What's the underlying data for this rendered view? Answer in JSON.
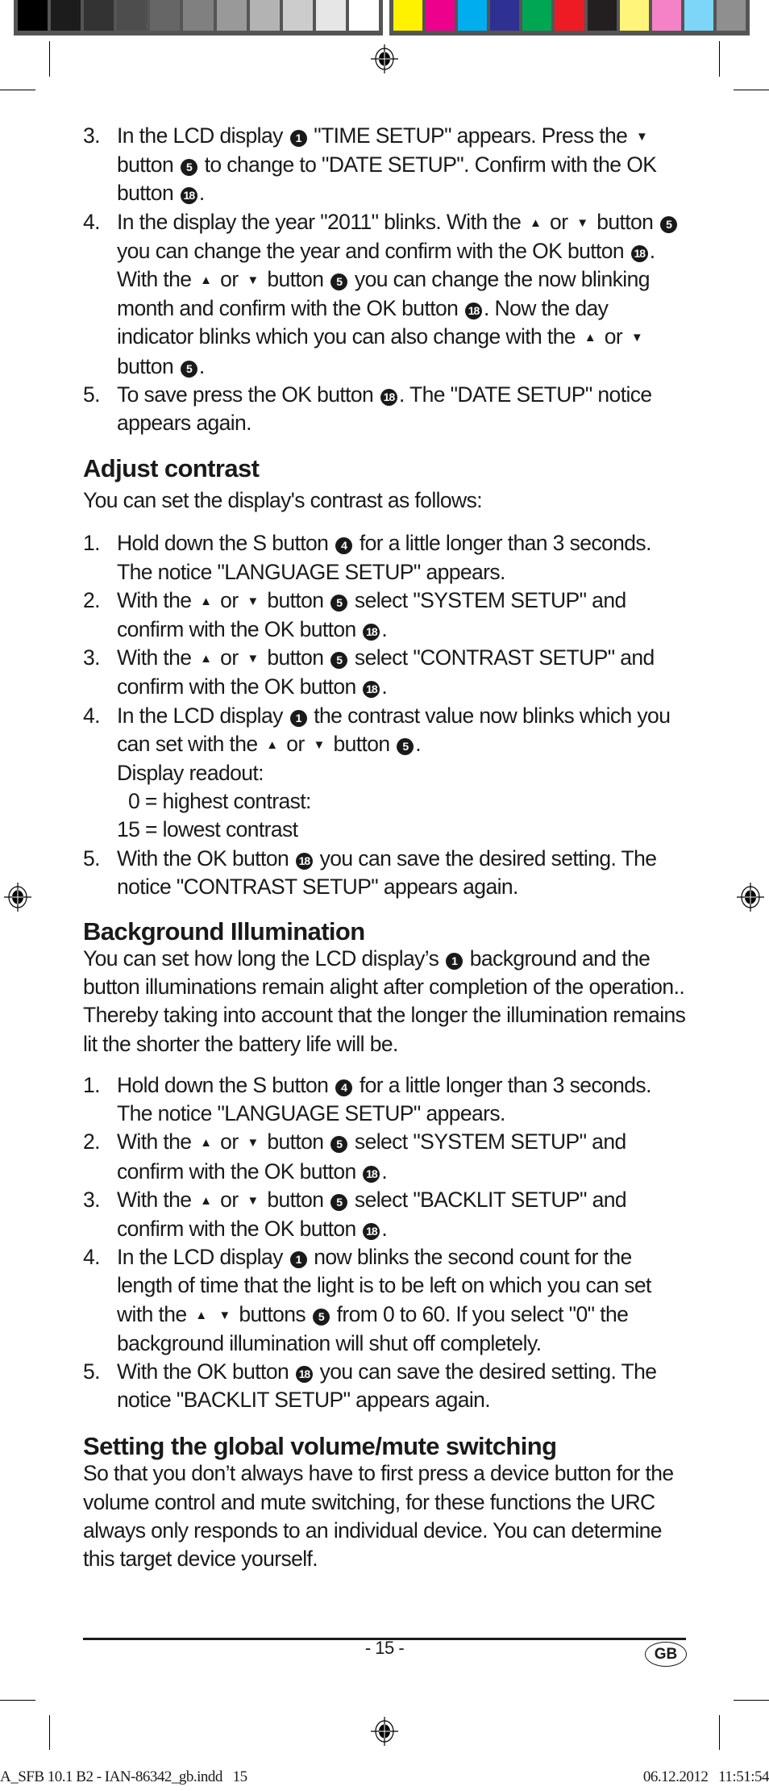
{
  "print_marks": {
    "gray_swatches": [
      "#000000",
      "#1c1c1c",
      "#333333",
      "#4d4d4d",
      "#666666",
      "#808080",
      "#999999",
      "#b3b3b3",
      "#cccccc",
      "#e6e6e6",
      "#ffffff"
    ],
    "color_swatches": [
      "#fff200",
      "#ec008c",
      "#00aeef",
      "#2e3192",
      "#00a651",
      "#ed1c24",
      "#231f20",
      "#fff57a",
      "#f582c6",
      "#7dd6f8",
      "#8f8f8f"
    ]
  },
  "date_setup_steps": [
    {
      "num": "3.",
      "parts": [
        "In the LCD display ",
        {
          "icon": "1"
        },
        " \"TIME SETUP\" appears. Press the ",
        {
          "tri": "down"
        },
        " button ",
        {
          "icon": "5"
        },
        " to change to \"DATE SETUP\". Confirm with the OK button ",
        {
          "icon": "18"
        },
        "."
      ]
    },
    {
      "num": "4.",
      "parts": [
        "In the display the year \"2011\" blinks. With the ",
        {
          "tri": "up"
        },
        " or ",
        {
          "tri": "down"
        },
        " button ",
        {
          "icon": "5"
        },
        " you can change the year and confirm with the OK button ",
        {
          "icon": "18"
        },
        ". With the ",
        {
          "tri": "up"
        },
        " or ",
        {
          "tri": "down"
        },
        " button ",
        {
          "icon": "5"
        },
        " you can change the now blinking month and confirm with the OK button ",
        {
          "icon": "18"
        },
        ". Now the day indicator blinks which you can also change with the ",
        {
          "tri": "up"
        },
        " or ",
        {
          "tri": "down"
        },
        " button ",
        {
          "icon": "5"
        },
        "."
      ]
    },
    {
      "num": "5.",
      "parts": [
        "To save press the OK button ",
        {
          "icon": "18"
        },
        ". The \"DATE SETUP\" notice appears again."
      ]
    }
  ],
  "contrast": {
    "heading": "Adjust contrast",
    "intro": "You can set the display's contrast as follows:",
    "steps": [
      {
        "num": "1.",
        "parts": [
          "Hold down the S button ",
          {
            "icon": "4"
          },
          " for a little longer than 3 sec­onds. The notice \"LANGUAGE SETUP\" appears."
        ]
      },
      {
        "num": "2.",
        "parts": [
          "With the ",
          {
            "tri": "up"
          },
          " or ",
          {
            "tri": "down"
          },
          " button ",
          {
            "icon": "5"
          },
          " select \"SYSTEM SETUP\" and confirm with the OK button ",
          {
            "icon": "18"
          },
          "."
        ]
      },
      {
        "num": "3.",
        "parts": [
          "With the ",
          {
            "tri": "up"
          },
          " or ",
          {
            "tri": "down"
          },
          " button ",
          {
            "icon": "5"
          },
          " select \"CONTRAST SETUP\" and confirm with the OK button ",
          {
            "icon": "18"
          },
          "."
        ]
      },
      {
        "num": "4.",
        "parts": [
          "In the LCD display ",
          {
            "icon": "1"
          },
          " the contrast value now blinks which you can set with the ",
          {
            "tri": "up"
          },
          " or ",
          {
            "tri": "down"
          },
          " button ",
          {
            "icon": "5"
          },
          "."
        ],
        "readout_label": "Display readout:",
        "readout_lines": [
          "0 = highest contrast:",
          "15 = lowest contrast"
        ]
      },
      {
        "num": "5.",
        "parts": [
          "With the OK button ",
          {
            "icon": "18"
          },
          " you can save the desired setting. The notice \"CONTRAST SETUP\" appears again."
        ]
      }
    ]
  },
  "backlight": {
    "heading": "Background Illumination",
    "intro_parts": [
      "You can set how long the LCD display’s ",
      {
        "icon": "1"
      },
      " background and the button illuminations remain alight after completion of the operation.. Thereby taking into account that the longer the il­lumination remains lit the shorter the battery life will be."
    ],
    "steps": [
      {
        "num": "1.",
        "parts": [
          "Hold down the S button ",
          {
            "icon": "4"
          },
          " for a little longer than 3 sec­onds. The notice \"LANGUAGE SETUP\" appears."
        ]
      },
      {
        "num": "2.",
        "parts": [
          "With the ",
          {
            "tri": "up"
          },
          " or ",
          {
            "tri": "down"
          },
          " button ",
          {
            "icon": "5"
          },
          " select \"SYSTEM SETUP\" and confirm with the OK button ",
          {
            "icon": "18"
          },
          "."
        ]
      },
      {
        "num": "3.",
        "parts": [
          "With the ",
          {
            "tri": "up"
          },
          " or ",
          {
            "tri": "down"
          },
          " button ",
          {
            "icon": "5"
          },
          " select \"BACKLIT SETUP\" and confirm with the OK button ",
          {
            "icon": "18"
          },
          "."
        ]
      },
      {
        "num": "4.",
        "parts": [
          "In the LCD display ",
          {
            "icon": "1"
          },
          " now blinks the second count for the length of time that the light is to be left on which you can set with the ",
          {
            "tri": "up"
          },
          " ",
          {
            "tri": "down"
          },
          " buttons ",
          {
            "icon": "5"
          },
          " from 0 to 60. If you select \"0\" the background illumination will shut off completely."
        ]
      },
      {
        "num": "5.",
        "parts": [
          "With the OK button ",
          {
            "icon": "18"
          },
          " you can save the desired setting. The notice \"BACKLIT SETUP\" appears again."
        ]
      }
    ]
  },
  "volume": {
    "heading": "Setting the global volume/mute switching",
    "intro": "So that you don’t always have to first press a device button for the volume control and mute switching, for these functions the URC always only responds to an individual device. You can determine this target device yourself."
  },
  "footer": {
    "page_number": "- 15 -",
    "language_badge": "GB",
    "slug_file": "A_SFB 10.1 B2 - IAN-86342_gb.indd   15",
    "slug_timestamp": "06.12.2012   11:51:54"
  }
}
